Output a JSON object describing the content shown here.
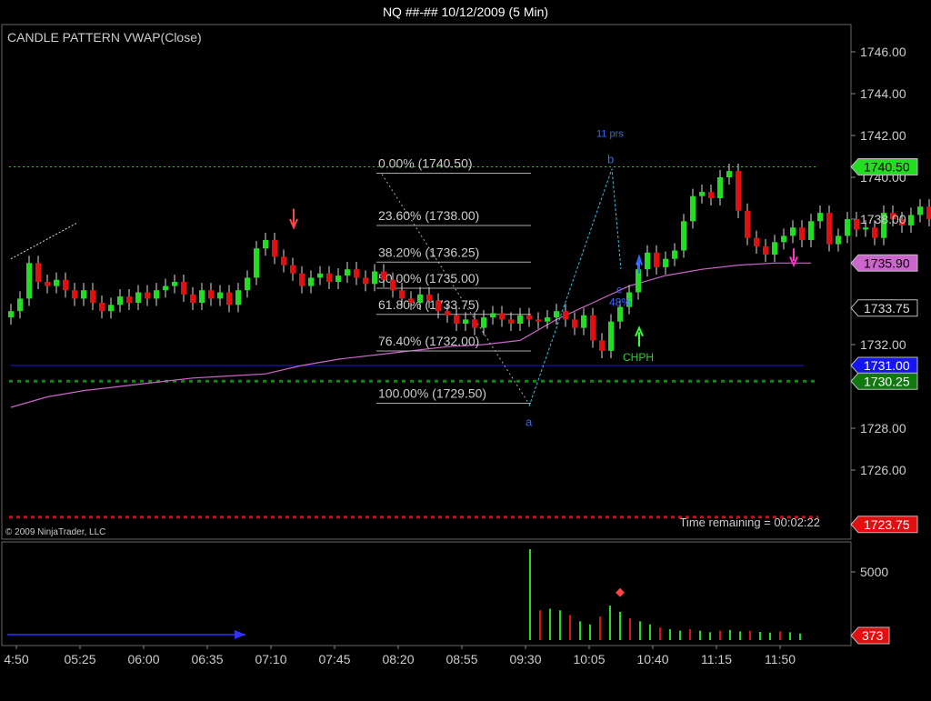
{
  "window": {
    "title": "NQ ##-##  10/12/2009 (5 Min)"
  },
  "panel": {
    "indicator_label": "CANDLE PATTERN VWAP(Close)",
    "copyright": "© 2009 NinjaTrader, LLC",
    "time_remaining": "Time remaining = 00:02:22"
  },
  "chart_data": {
    "type": "candlestick",
    "instrument": "NQ ##-##",
    "date": "10/12/2009",
    "interval": "5 Min",
    "ylim": [
      1724.5,
      1747.0
    ],
    "y_ticks": [
      "1746.00",
      "1744.00",
      "1742.00",
      "1740.00",
      "1738.00",
      "1732.00",
      "1728.00",
      "1726.00"
    ],
    "x_ticks": [
      "4:50",
      "05:25",
      "06:00",
      "06:35",
      "07:10",
      "07:45",
      "08:20",
      "08:55",
      "09:30",
      "10:05",
      "10:40",
      "11:15",
      "11:50"
    ],
    "price_markers": [
      {
        "label": "1740.50",
        "value": 1740.5,
        "color": "#22dd22",
        "text_color": "#000"
      },
      {
        "label": "1735.90",
        "value": 1735.9,
        "color": "#cc66cc",
        "text_color": "#000"
      },
      {
        "label": "1733.75",
        "value": 1733.75,
        "color": "#000",
        "text_color": "#ddd"
      },
      {
        "label": "1731.00",
        "value": 1731.0,
        "color": "#1515ee",
        "text_color": "#fff"
      },
      {
        "label": "1730.25",
        "value": 1730.25,
        "color": "#117711",
        "text_color": "#fff"
      },
      {
        "label": "1723.75",
        "value": 1723.75,
        "color": "#e01010",
        "text_color": "#fff"
      }
    ],
    "fibonacci": [
      {
        "label": "0.00% (1740.50)",
        "value": 1740.5
      },
      {
        "label": "23.60% (1738.00)",
        "value": 1738.0
      },
      {
        "label": "38.20% (1736.25)",
        "value": 1736.25
      },
      {
        "label": "50.00% (1735.00)",
        "value": 1735.0
      },
      {
        "label": "61.80% (1733.75)",
        "value": 1733.75
      },
      {
        "label": "76.40% (1732.00)",
        "value": 1732.0
      },
      {
        "label": "100.00% (1729.50)",
        "value": 1729.5
      }
    ],
    "annotations": {
      "a": "a",
      "b": "b",
      "c": "c",
      "bars": "11 prs",
      "pct": "48%",
      "pattern": "CHPH"
    },
    "volume": {
      "ytick": "5000",
      "last": "373"
    }
  }
}
